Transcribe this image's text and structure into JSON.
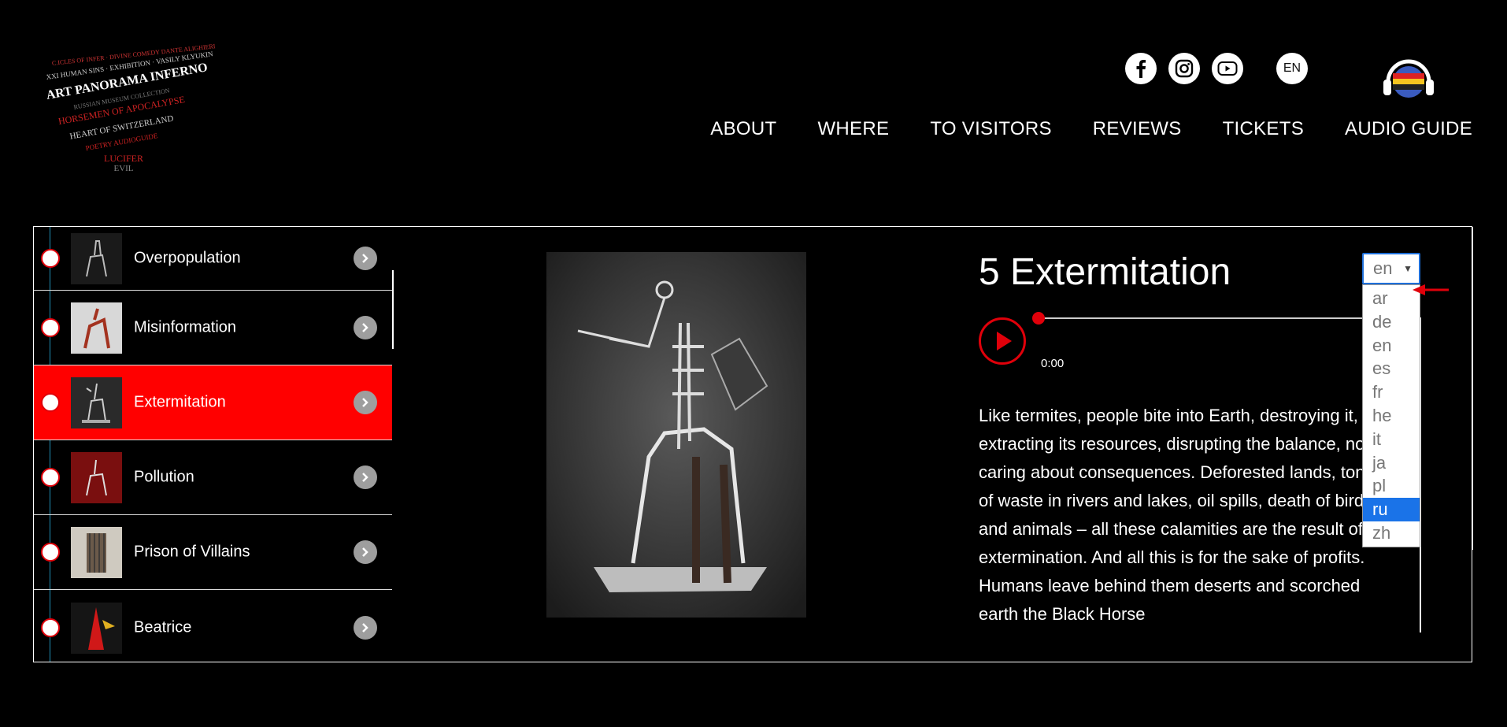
{
  "header": {
    "logo_lines": [
      "C.ICLES OF INFER · DIVINE COMEDY DANTE ALIGHIERI",
      "XXI HUMAN SINS · EXHIBITION · VASILY KLYUKIN",
      "ART PANORAMA INFERNO",
      "RUSSIAN MUSEUM COLLECTION",
      "HORSEMEN OF APOCALYPSE",
      "HEART OF SWITZERLAND",
      "POETRY AUDIOGUIDE",
      "LUCIFER",
      "EVIL"
    ],
    "social_icons": [
      "facebook-icon",
      "instagram-icon",
      "youtube-icon"
    ],
    "language": "EN",
    "nav": [
      "ABOUT",
      "WHERE",
      "TO VISITORS",
      "REVIEWS",
      "TICKETS",
      "AUDIO GUIDE"
    ]
  },
  "sidebar": {
    "items": [
      {
        "label": "Overpopulation",
        "active": false
      },
      {
        "label": "Misinformation",
        "active": false
      },
      {
        "label": "Extermitation",
        "active": true
      },
      {
        "label": "Pollution",
        "active": false
      },
      {
        "label": "Prison of Villains",
        "active": false
      },
      {
        "label": "Beatrice",
        "active": false
      }
    ]
  },
  "detail": {
    "title": "5 Extermitation",
    "time": "0:00",
    "progress": 0,
    "description": "Like termites, people bite into Earth, destroying it, extracting its resources, disrupting the balance, not caring about consequences. Deforested lands, tons of waste in rivers and lakes, oil spills, death of birds and animals – all these calamities are the result of extermination. And all this is for the sake of profits. Humans leave behind them deserts and scorched earth the Black Horse"
  },
  "language_select": {
    "value": "en",
    "options": [
      "ar",
      "de",
      "en",
      "es",
      "fr",
      "he",
      "it",
      "ja",
      "pl",
      "ru",
      "zh"
    ],
    "highlighted": "ru"
  },
  "colors": {
    "accent": "#ff0000",
    "background": "#000000"
  }
}
